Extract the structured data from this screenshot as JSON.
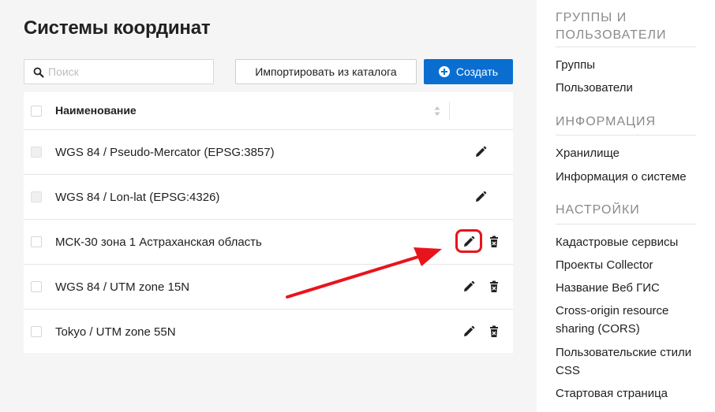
{
  "main": {
    "title": "Системы координат",
    "search": {
      "placeholder": "Поиск",
      "icon": "search-icon"
    },
    "buttons": {
      "import_label": "Импортировать из каталога",
      "create_label": "Создать",
      "create_color": "#0a6ed1"
    },
    "table": {
      "header": {
        "name": "Наименование"
      },
      "rows": [
        {
          "name": "WGS 84 / Pseudo-Mercator (EPSG:3857)",
          "checkbox_enabled": false,
          "actions": [
            "edit"
          ]
        },
        {
          "name": "WGS 84 / Lon-lat (EPSG:4326)",
          "checkbox_enabled": false,
          "actions": [
            "edit"
          ]
        },
        {
          "name": "МСК-30 зона 1 Астраханская область",
          "checkbox_enabled": true,
          "actions": [
            "edit",
            "delete"
          ],
          "highlighted_action": "edit"
        },
        {
          "name": "WGS 84 / UTM zone 15N",
          "checkbox_enabled": true,
          "actions": [
            "edit",
            "delete"
          ]
        },
        {
          "name": "Tokyo / UTM zone 55N",
          "checkbox_enabled": true,
          "actions": [
            "edit",
            "delete"
          ]
        }
      ]
    },
    "annotation": {
      "color": "#e8141c"
    }
  },
  "sidebar": {
    "sections": [
      {
        "heading": "Группы и пользователи",
        "items": [
          "Группы",
          "Пользователи"
        ]
      },
      {
        "heading": "Информация",
        "items": [
          "Хранилище",
          "Информация о системе"
        ]
      },
      {
        "heading": "Настройки",
        "items": [
          "Кадастровые сервисы",
          "Проекты Collector",
          "Название Веб ГИС",
          "Cross-origin resource sharing (CORS)",
          "Пользовательские стили CSS",
          "Стартовая страница"
        ]
      }
    ]
  }
}
